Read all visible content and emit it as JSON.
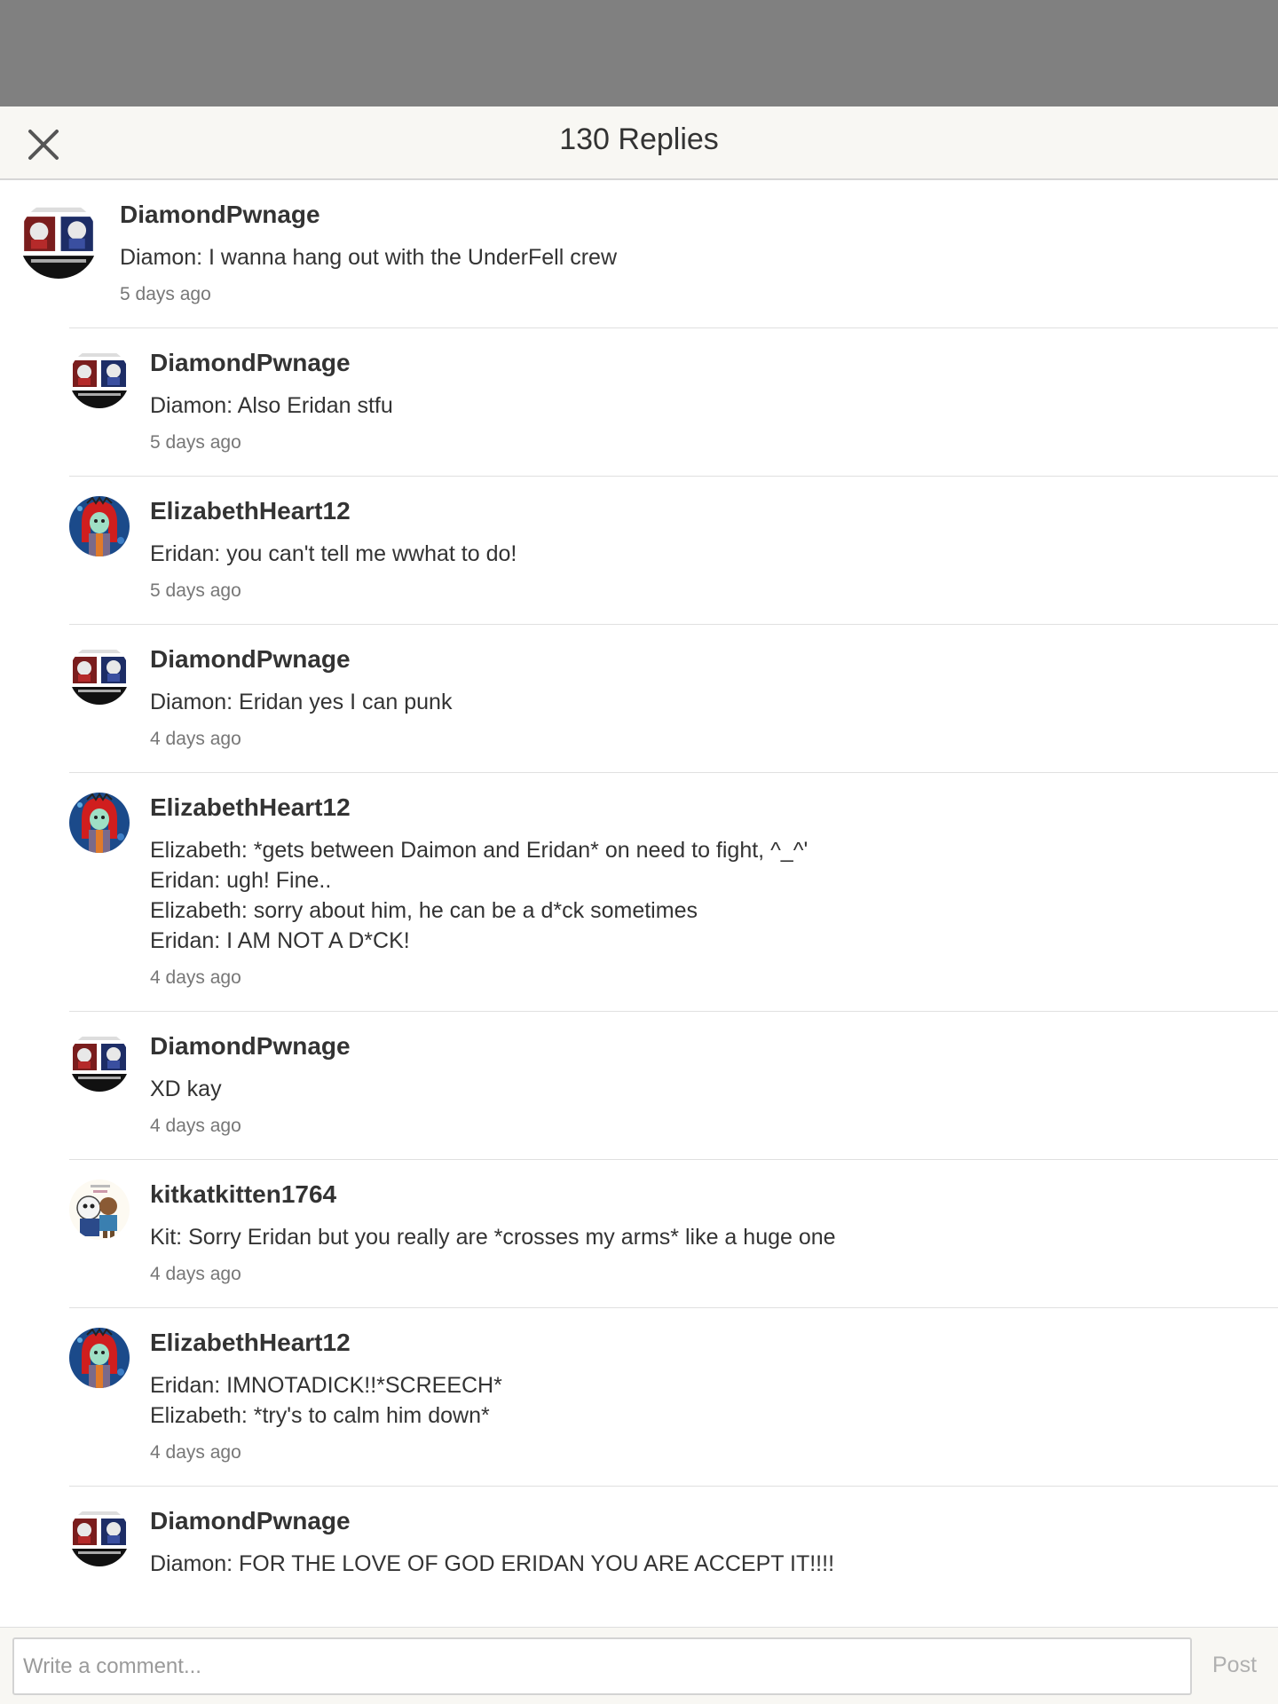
{
  "header": {
    "title": "130 Replies",
    "close_icon": "close-icon"
  },
  "replies": [
    {
      "username": "DiamondPwnage",
      "avatar": "diamond",
      "text": "Diamon: I wanna hang out with the UnderFell crew",
      "time": "5 days ago"
    },
    {
      "username": "DiamondPwnage",
      "avatar": "diamond",
      "text": "Diamon: Also Eridan stfu",
      "time": "5 days ago"
    },
    {
      "username": "ElizabethHeart12",
      "avatar": "elizabeth",
      "text": "Eridan: you can't tell me wwhat to do!",
      "time": "5 days ago"
    },
    {
      "username": "DiamondPwnage",
      "avatar": "diamond",
      "text": "Diamon: Eridan yes I can punk",
      "time": "4 days ago"
    },
    {
      "username": "ElizabethHeart12",
      "avatar": "elizabeth",
      "text": "Elizabeth: *gets between Daimon and Eridan* on need to fight, ^_^'\nEridan: ugh! Fine..\nElizabeth: sorry about him, he can be a d*ck sometimes\nEridan: I AM NOT A D*CK!",
      "time": "4 days ago"
    },
    {
      "username": "DiamondPwnage",
      "avatar": "diamond",
      "text": "XD kay",
      "time": "4 days ago"
    },
    {
      "username": "kitkatkitten1764",
      "avatar": "kitkat",
      "text": "Kit: Sorry Eridan but you really are *crosses my arms* like a huge one",
      "time": "4 days ago"
    },
    {
      "username": "ElizabethHeart12",
      "avatar": "elizabeth",
      "text": "Eridan: IMNOTADICK!!*SCREECH*\nElizabeth: *try's to calm him down*",
      "time": "4 days ago"
    },
    {
      "username": "DiamondPwnage",
      "avatar": "diamond",
      "text": "Diamon: FOR THE LOVE OF GOD ERIDAN YOU ARE ACCEPT IT!!!!",
      "time": ""
    }
  ],
  "composer": {
    "placeholder": "Write a comment...",
    "post_label": "Post"
  }
}
